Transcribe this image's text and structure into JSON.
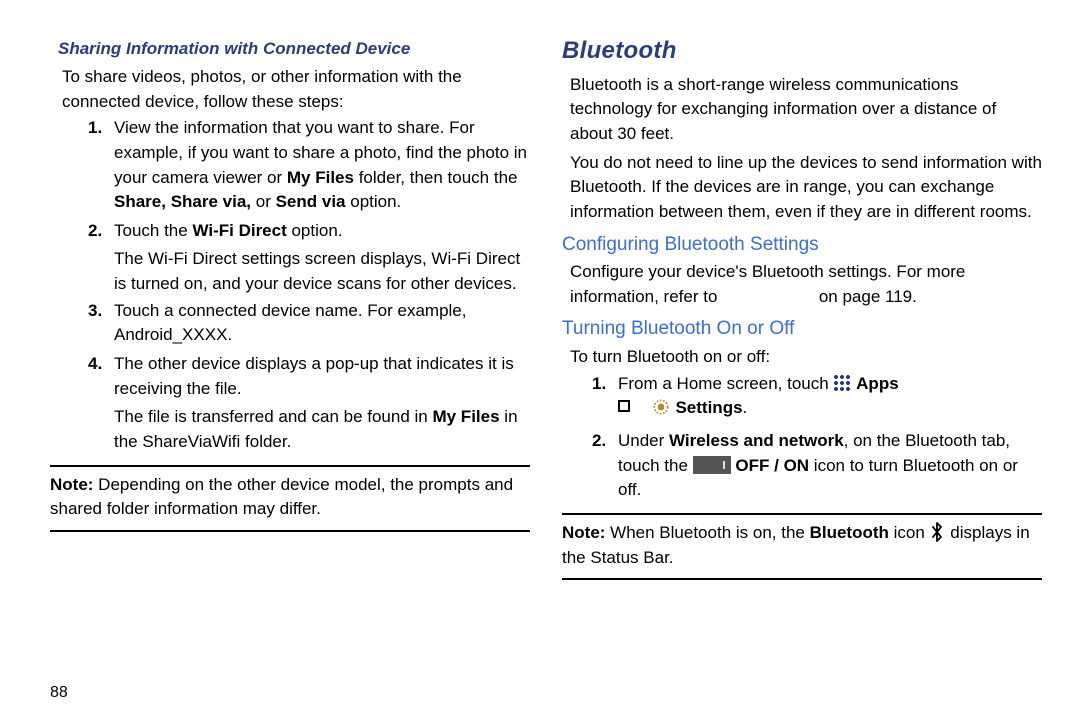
{
  "pageNumber": "88",
  "left": {
    "sharingHeading": "Sharing Information with Connected Device",
    "intro": "To share videos, photos, or other information with the connected device, follow these steps:",
    "steps": [
      {
        "num": "1.",
        "body_a": "View the information that you want to share. For example, if you want to share a photo, find the photo in your camera viewer or ",
        "body_bold1": "My Files",
        "body_b": " folder, then touch the ",
        "body_bold2": "Share, Share via,",
        "body_c": " or ",
        "body_bold3": "Send via",
        "body_d": " option."
      },
      {
        "num": "2.",
        "body_a": "Touch the ",
        "body_bold1": "Wi-Fi Direct",
        "body_b": " option.",
        "cont": "The Wi-Fi Direct settings screen displays, Wi-Fi Direct is turned on, and your device scans for other devices."
      },
      {
        "num": "3.",
        "body_a": "Touch a connected device name. For example, Android_XXXX."
      },
      {
        "num": "4.",
        "body_a": "The other device displays a pop-up that indicates it is receiving the file.",
        "cont_a": "The file is transferred and can be found in ",
        "cont_bold": "My Files",
        "cont_b": " in the ShareViaWifi folder."
      }
    ],
    "noteLabel": "Note:",
    "noteText": " Depending on the other device model, the prompts and shared folder information may differ."
  },
  "right": {
    "title": "Bluetooth",
    "intro1": "Bluetooth is a short-range wireless communications technology for exchanging information over a distance of about 30 feet.",
    "intro2": "You do not need to line up the devices to send information with Bluetooth. If the devices are in range, you can exchange information between them, even if they are in different rooms.",
    "configHeading": "Configuring Bluetooth Settings",
    "configBody_a": "Configure your device's Bluetooth settings. For more information, refer to ",
    "configBody_b": " on page 119.",
    "toggleHeading": "Turning Bluetooth On or Off",
    "toggleIntro": "To turn Bluetooth on or off:",
    "step1_num": "1.",
    "step1_a": "From a Home screen, touch ",
    "step1_apps": " Apps",
    "step1_arrow": "➔",
    "step1_settings": " Settings",
    "step1_end": ".",
    "step2_num": "2.",
    "step2_a": "Under ",
    "step2_bold1": "Wireless and network",
    "step2_b": ", on the Bluetooth tab, touch the ",
    "step2_bold2": " OFF / ON",
    "step2_c": " icon to turn Bluetooth on or off.",
    "noteLabel": "Note:",
    "note_a": " When Bluetooth is on, the ",
    "note_bold": "Bluetooth",
    "note_b": " icon ",
    "note_c": " displays in the Status Bar."
  }
}
